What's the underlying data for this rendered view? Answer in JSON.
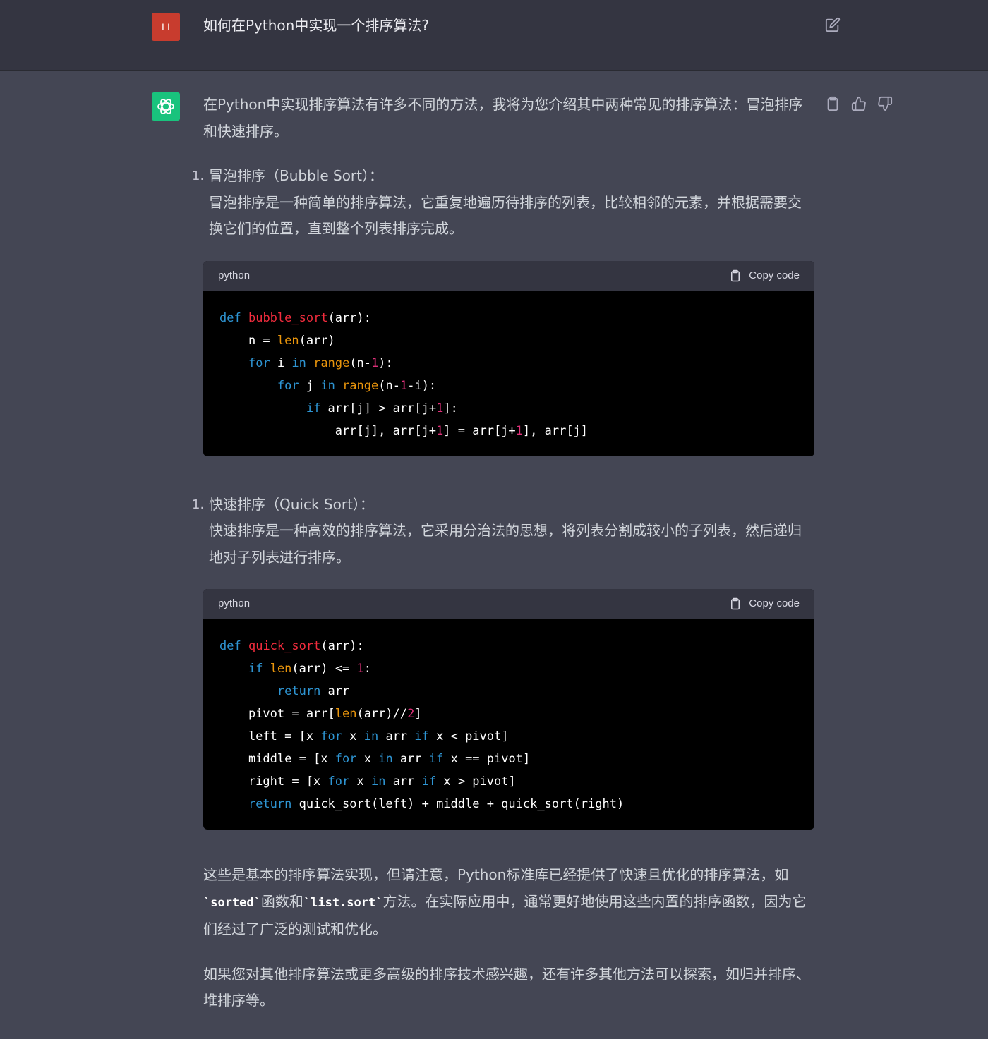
{
  "user": {
    "avatar_initials": "LI",
    "question": "如何在Python中实现一个排序算法?"
  },
  "assistant": {
    "intro": "在Python中实现排序算法有许多不同的方法，我将为您介绍其中两种常见的排序算法：冒泡排序和快速排序。",
    "sections": [
      {
        "number": "1.",
        "title": "冒泡排序（Bubble Sort）：",
        "description": "冒泡排序是一种简单的排序算法，它重复地遍历待排序的列表，比较相邻的元素，并根据需要交换它们的位置，直到整个列表排序完成。",
        "code_lang": "python",
        "copy_label": "Copy code"
      },
      {
        "number": "1.",
        "title": "快速排序（Quick Sort）：",
        "description": "快速排序是一种高效的排序算法，它采用分治法的思想，将列表分割成较小的子列表，然后递归地对子列表进行排序。",
        "code_lang": "python",
        "copy_label": "Copy code"
      }
    ],
    "code_bubble": [
      "def bubble_sort(arr):",
      "    n = len(arr)",
      "    for i in range(n-1):",
      "        for j in range(n-1-i):",
      "            if arr[j] > arr[j+1]:",
      "                arr[j], arr[j+1] = arr[j+1], arr[j]"
    ],
    "code_quick": [
      "def quick_sort(arr):",
      "    if len(arr) <= 1:",
      "        return arr",
      "    pivot = arr[len(arr)//2]",
      "    left = [x for x in arr if x < pivot]",
      "    middle = [x for x in arr if x == pivot]",
      "    right = [x for x in arr if x > pivot]",
      "    return quick_sort(left) + middle + quick_sort(right)"
    ],
    "closing_1_part1": "这些是基本的排序算法实现，但请注意，Python标准库已经提供了快速且优化的排序算法，如",
    "closing_1_code1": "`sorted`",
    "closing_1_part2": "函数和",
    "closing_1_code2": "`list.sort`",
    "closing_1_part3": "方法。在实际应用中，通常更好地使用这些内置的排序函数，因为它们经过了广泛的测试和优化。",
    "closing_2": "如果您对其他排序算法或更多高级的排序技术感兴趣，还有许多其他方法可以探索，如归并排序、堆排序等。"
  },
  "colors": {
    "background": "#444654",
    "user_row": "#343541",
    "user_avatar": "#c83c2e",
    "bot_avatar": "#19c37d",
    "code_bg": "#000000",
    "keyword": "#2e95d3",
    "function": "#f22c3d",
    "builtin": "#e9950c",
    "number": "#df3079"
  },
  "icons": [
    "edit-icon",
    "openai-logo-icon",
    "clipboard-icon",
    "thumbs-up-icon",
    "thumbs-down-icon"
  ]
}
